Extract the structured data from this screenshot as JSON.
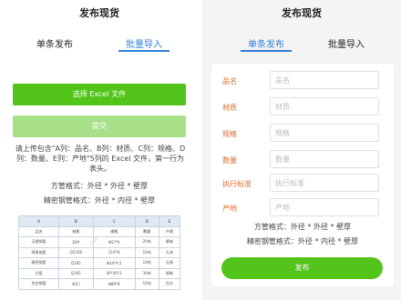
{
  "left": {
    "page_title": "发布现货",
    "tabs": [
      {
        "label": "单条发布"
      },
      {
        "label": "批量导入"
      }
    ],
    "select_excel_label": "选择 Excel 文件",
    "submit_label": "提交",
    "instructions": "请上传包含\"A列：品名、B列：材质、C列：规格、D列：数量、E列：产地\"5列的 Excel 文件，第一行为表头。",
    "format_square": "方管格式：外径 * 外径 * 壁厚",
    "format_precision": "精密钢管格式：外径 * 内径 * 壁厚",
    "sample_table": {
      "letters": [
        "A",
        "B",
        "C",
        "D",
        "E"
      ],
      "headers": [
        "品名",
        "材质",
        "规格",
        "数量",
        "产地"
      ],
      "rows": [
        [
          "无缝钢管",
          "20#",
          "Φ57*6",
          "20吨",
          "聊城"
        ],
        [
          "焊接钢管",
          "Q235B",
          "219*8",
          "15吨",
          "天津"
        ],
        [
          "精密钢管",
          "Q195",
          "Φ34*4.5",
          "10吨",
          "无锡"
        ],
        [
          "方管",
          "Q345",
          "40*40*3",
          "30吨",
          "邯郸"
        ],
        [
          "合金钢管",
          "40Cr",
          "Φ89*8",
          "12吨",
          "包头"
        ]
      ],
      "watermark": "示例"
    }
  },
  "right": {
    "page_title": "发布现货",
    "tabs": [
      {
        "label": "单条发布"
      },
      {
        "label": "批量导入"
      }
    ],
    "fields": [
      {
        "label": "品名",
        "placeholder": "品名"
      },
      {
        "label": "材质",
        "placeholder": "材质"
      },
      {
        "label": "规格",
        "placeholder": "规格"
      },
      {
        "label": "数量",
        "placeholder": "数量"
      },
      {
        "label": "执行标准",
        "placeholder": "执行标准"
      },
      {
        "label": "产地",
        "placeholder": "产地"
      }
    ],
    "format_square": "方管格式：外径 * 外径 * 壁厚",
    "format_precision": "精密钢管格式：外径 * 内径 * 壁厚",
    "publish_label": "发布"
  },
  "colors": {
    "green": "#52c41a",
    "green_light": "#a8e08a",
    "blue": "#2f7fd6",
    "label_orange": "#e36a2b"
  }
}
